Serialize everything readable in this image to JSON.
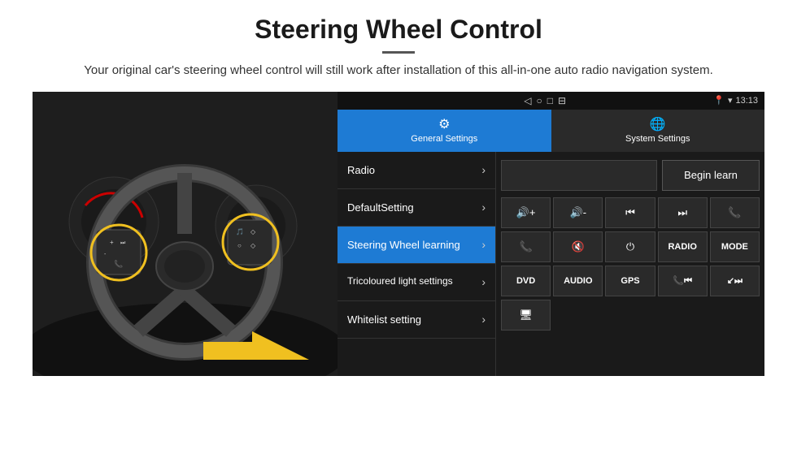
{
  "header": {
    "title": "Steering Wheel Control",
    "subtitle": "Your original car's steering wheel control will still work after installation of this all-in-one auto radio navigation system."
  },
  "status_bar": {
    "time": "13:13",
    "nav_icons": [
      "◁",
      "○",
      "□",
      "⊟"
    ]
  },
  "tabs": [
    {
      "id": "general",
      "label": "General Settings",
      "icon": "⚙",
      "active": true
    },
    {
      "id": "system",
      "label": "System Settings",
      "icon": "🌐",
      "active": false
    }
  ],
  "menu_items": [
    {
      "id": "radio",
      "label": "Radio",
      "active": false
    },
    {
      "id": "default",
      "label": "DefaultSetting",
      "active": false
    },
    {
      "id": "steering",
      "label": "Steering Wheel learning",
      "active": true
    },
    {
      "id": "tricoloured",
      "label": "Tricoloured light settings",
      "active": false
    },
    {
      "id": "whitelist",
      "label": "Whitelist setting",
      "active": false
    }
  ],
  "right_panel": {
    "begin_learn_label": "Begin learn",
    "control_buttons_row1": [
      {
        "icon": "🔊+",
        "type": "vol_up"
      },
      {
        "icon": "🔊-",
        "type": "vol_down"
      },
      {
        "icon": "⏮",
        "type": "prev"
      },
      {
        "icon": "⏭",
        "type": "next"
      },
      {
        "icon": "📞",
        "type": "call"
      }
    ],
    "control_buttons_row2": [
      {
        "icon": "📞↓",
        "type": "hang_up"
      },
      {
        "icon": "🔇",
        "type": "mute"
      },
      {
        "icon": "⏻",
        "type": "power"
      },
      {
        "text": "RADIO",
        "type": "radio"
      },
      {
        "text": "MODE",
        "type": "mode"
      }
    ],
    "bottom_buttons": [
      {
        "text": "DVD"
      },
      {
        "text": "AUDIO"
      },
      {
        "text": "GPS"
      },
      {
        "icon": "📞⏮",
        "type": "call_prev"
      },
      {
        "icon": "↙⏭",
        "type": "call_next"
      }
    ],
    "last_row_icon": "🖥"
  }
}
